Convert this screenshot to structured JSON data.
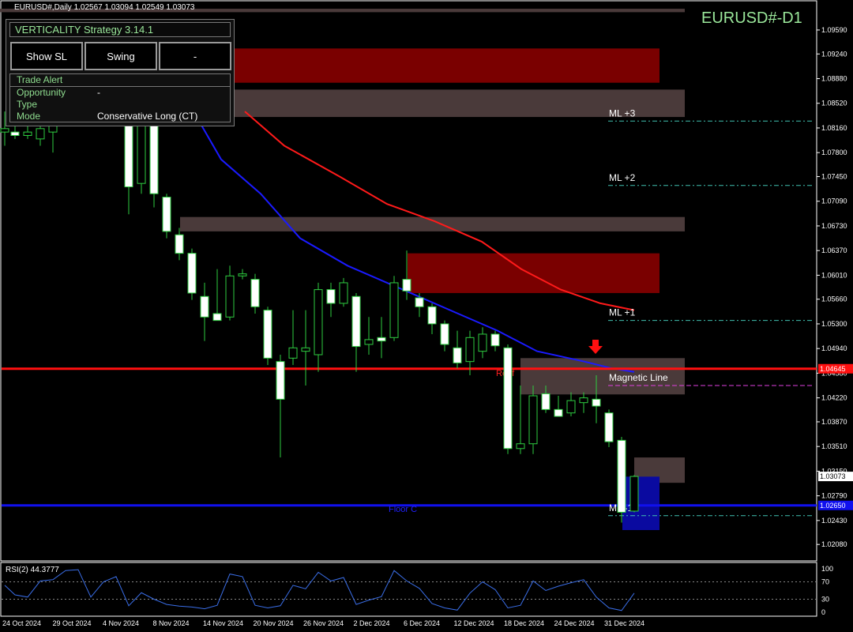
{
  "header": {
    "symbol_info": "EURUSD#,Daily  1.02567 1.03094 1.02549 1.03073",
    "title": "EURUSD#-D1"
  },
  "panel": {
    "title": "VERTICALITY Strategy 3.14.1",
    "buttons": [
      "Show SL",
      "Swing",
      "-"
    ],
    "rows": [
      {
        "key": "Trade Alert",
        "value": ""
      },
      {
        "key": "Opportunity",
        "value": "-"
      },
      {
        "key": "Type",
        "value": ""
      },
      {
        "key": "Mode",
        "value": "Conservative Long  (CT)"
      }
    ]
  },
  "chart_data": {
    "type": "candlestick",
    "y_range": [
      1.0184,
      1.0997
    ],
    "price_ticks": [
      "1.09590",
      "1.09240",
      "1.08880",
      "1.08520",
      "1.08160",
      "1.07800",
      "1.07450",
      "1.07090",
      "1.06730",
      "1.06370",
      "1.06010",
      "1.05660",
      "1.05300",
      "1.04940",
      "1.04580",
      "1.04220",
      "1.03870",
      "1.03510",
      "1.03150",
      "1.02790",
      "1.02430",
      "1.02080"
    ],
    "x_labels": [
      "24 Oct 2024",
      "29 Oct 2024",
      "4 Nov 2024",
      "8 Nov 2024",
      "14 Nov 2024",
      "20 Nov 2024",
      "26 Nov 2024",
      "2 Dec 2024",
      "6 Dec 2024",
      "12 Dec 2024",
      "18 Dec 2024",
      "24 Dec 2024",
      "31 Dec 2024"
    ],
    "current_price": "1.03073",
    "roof": {
      "value": 1.04645,
      "label": "1.04645",
      "text": "Roof"
    },
    "floor": {
      "value": 1.0265,
      "label": "1.02650",
      "text": "Floor C"
    },
    "levels": [
      {
        "name": "ML +3",
        "value": 1.0826
      },
      {
        "name": "ML +2",
        "value": 1.0732
      },
      {
        "name": "ML +1",
        "value": 1.0535
      },
      {
        "name": "Magnetic Line",
        "value": 1.044
      },
      {
        "name": "ML -1",
        "value": 1.025
      }
    ],
    "candles": [
      {
        "x": 6,
        "o": 1.081,
        "h": 1.084,
        "l": 1.079,
        "c": 1.0815
      },
      {
        "x": 19,
        "o": 1.081,
        "h": 1.083,
        "l": 1.08,
        "c": 1.0805
      },
      {
        "x": 35,
        "o": 1.0805,
        "h": 1.0825,
        "l": 1.08,
        "c": 1.081
      },
      {
        "x": 51,
        "o": 1.08,
        "h": 1.0825,
        "l": 1.079,
        "c": 1.0815
      },
      {
        "x": 67,
        "o": 1.081,
        "h": 1.083,
        "l": 1.078,
        "c": 1.082
      },
      {
        "x": 163,
        "o": 1.0838,
        "h": 1.085,
        "l": 1.069,
        "c": 1.073
      },
      {
        "x": 179,
        "o": 1.0735,
        "h": 1.086,
        "l": 1.072,
        "c": 1.084
      },
      {
        "x": 195,
        "o": 1.084,
        "h": 1.085,
        "l": 1.07,
        "c": 1.072
      },
      {
        "x": 211,
        "o": 1.0715,
        "h": 1.072,
        "l": 1.0655,
        "c": 1.0665
      },
      {
        "x": 227,
        "o": 1.066,
        "h": 1.067,
        "l": 1.0623,
        "c": 1.0633
      },
      {
        "x": 243,
        "o": 1.0633,
        "h": 1.064,
        "l": 1.0565,
        "c": 1.0575
      },
      {
        "x": 259,
        "o": 1.057,
        "h": 1.059,
        "l": 1.0505,
        "c": 1.054
      },
      {
        "x": 275,
        "o": 1.0545,
        "h": 1.061,
        "l": 1.054,
        "c": 1.0535
      },
      {
        "x": 291,
        "o": 1.054,
        "h": 1.0615,
        "l": 1.0535,
        "c": 1.06
      },
      {
        "x": 307,
        "o": 1.06,
        "h": 1.061,
        "l": 1.0595,
        "c": 1.0603
      },
      {
        "x": 323,
        "o": 1.0595,
        "h": 1.0603,
        "l": 1.0545,
        "c": 1.0555
      },
      {
        "x": 339,
        "o": 1.055,
        "h": 1.0555,
        "l": 1.047,
        "c": 1.048
      },
      {
        "x": 355,
        "o": 1.0475,
        "h": 1.0485,
        "l": 1.0335,
        "c": 1.042
      },
      {
        "x": 371,
        "o": 1.048,
        "h": 1.055,
        "l": 1.047,
        "c": 1.0495
      },
      {
        "x": 387,
        "o": 1.049,
        "h": 1.055,
        "l": 1.044,
        "c": 1.0495
      },
      {
        "x": 403,
        "o": 1.0485,
        "h": 1.059,
        "l": 1.046,
        "c": 1.058
      },
      {
        "x": 419,
        "o": 1.058,
        "h": 1.059,
        "l": 1.054,
        "c": 1.056
      },
      {
        "x": 435,
        "o": 1.056,
        "h": 1.0597,
        "l": 1.0555,
        "c": 1.059
      },
      {
        "x": 451,
        "o": 1.057,
        "h": 1.0575,
        "l": 1.046,
        "c": 1.0497
      },
      {
        "x": 467,
        "o": 1.05,
        "h": 1.054,
        "l": 1.0485,
        "c": 1.0507
      },
      {
        "x": 483,
        "o": 1.051,
        "h": 1.054,
        "l": 1.048,
        "c": 1.0505
      },
      {
        "x": 499,
        "o": 1.051,
        "h": 1.06,
        "l": 1.0505,
        "c": 1.059
      },
      {
        "x": 515,
        "o": 1.0595,
        "h": 1.0637,
        "l": 1.0565,
        "c": 1.0578
      },
      {
        "x": 531,
        "o": 1.0568,
        "h": 1.0575,
        "l": 1.054,
        "c": 1.0555
      },
      {
        "x": 547,
        "o": 1.0555,
        "h": 1.056,
        "l": 1.0515,
        "c": 1.053
      },
      {
        "x": 563,
        "o": 1.053,
        "h": 1.0535,
        "l": 1.049,
        "c": 1.05
      },
      {
        "x": 579,
        "o": 1.0495,
        "h": 1.052,
        "l": 1.0465,
        "c": 1.0473
      },
      {
        "x": 595,
        "o": 1.0475,
        "h": 1.052,
        "l": 1.0455,
        "c": 1.051
      },
      {
        "x": 611,
        "o": 1.049,
        "h": 1.0525,
        "l": 1.048,
        "c": 1.0515
      },
      {
        "x": 627,
        "o": 1.0515,
        "h": 1.052,
        "l": 1.049,
        "c": 1.0498
      },
      {
        "x": 643,
        "o": 1.0495,
        "h": 1.05,
        "l": 1.034,
        "c": 1.0348
      },
      {
        "x": 659,
        "o": 1.0348,
        "h": 1.044,
        "l": 1.034,
        "c": 1.0355
      },
      {
        "x": 675,
        "o": 1.0355,
        "h": 1.044,
        "l": 1.034,
        "c": 1.0425
      },
      {
        "x": 691,
        "o": 1.0428,
        "h": 1.044,
        "l": 1.04,
        "c": 1.0405
      },
      {
        "x": 707,
        "o": 1.0405,
        "h": 1.0425,
        "l": 1.0395,
        "c": 1.0395
      },
      {
        "x": 723,
        "o": 1.04,
        "h": 1.043,
        "l": 1.0395,
        "c": 1.0418
      },
      {
        "x": 739,
        "o": 1.0415,
        "h": 1.043,
        "l": 1.04,
        "c": 1.0422
      },
      {
        "x": 755,
        "o": 1.042,
        "h": 1.0455,
        "l": 1.0385,
        "c": 1.041
      },
      {
        "x": 771,
        "o": 1.04,
        "h": 1.0405,
        "l": 1.035,
        "c": 1.0358
      },
      {
        "x": 787,
        "o": 1.036,
        "h": 1.0365,
        "l": 1.024,
        "c": 1.0255
      },
      {
        "x": 803,
        "o": 1.02567,
        "h": 1.03094,
        "l": 1.02549,
        "c": 1.03073
      }
    ],
    "ma_red": [
      [
        310,
        1.084
      ],
      [
        360,
        1.079
      ],
      [
        430,
        1.0745
      ],
      [
        490,
        1.0705
      ],
      [
        550,
        1.068
      ],
      [
        610,
        1.065
      ],
      [
        660,
        1.061
      ],
      [
        710,
        1.058
      ],
      [
        760,
        1.056
      ],
      [
        803,
        1.055
      ]
    ],
    "ma_blue": [
      [
        240,
        1.085
      ],
      [
        280,
        1.077
      ],
      [
        330,
        1.072
      ],
      [
        380,
        1.0655
      ],
      [
        440,
        1.0615
      ],
      [
        510,
        1.058
      ],
      [
        580,
        1.0545
      ],
      [
        630,
        1.052
      ],
      [
        680,
        1.049
      ],
      [
        740,
        1.0475
      ],
      [
        775,
        1.0465
      ],
      [
        803,
        1.046
      ]
    ],
    "zones": [
      {
        "x1": 292,
        "x2": 835,
        "top": 1.0932,
        "bot": 1.0882,
        "color": "#7a0000"
      },
      {
        "x1": 292,
        "x2": 867,
        "top": 1.0872,
        "bot": 1.0832,
        "color": "#4a3a3a"
      },
      {
        "x1": 0,
        "x2": 867,
        "top": 1.099,
        "bot": 1.0985,
        "color": "#4a3a3a"
      },
      {
        "x1": 228,
        "x2": 867,
        "top": 1.0686,
        "bot": 1.0665,
        "color": "#4a3a3a"
      },
      {
        "x1": 516,
        "x2": 835,
        "top": 1.0633,
        "bot": 1.0575,
        "color": "#7a0000"
      },
      {
        "x1": 659,
        "x2": 867,
        "top": 1.048,
        "bot": 1.0427,
        "color": "#4a3a3a"
      },
      {
        "x1": 803,
        "x2": 867,
        "top": 1.0335,
        "bot": 1.0298,
        "color": "#4a3a3a"
      },
      {
        "x1": 788,
        "x2": 835,
        "top": 1.0307,
        "bot": 1.0229,
        "color": "#0a0aa0"
      }
    ],
    "rsi": {
      "label": "RSI(2) 44.3777",
      "ticks": [
        "100",
        "70",
        "30",
        "0"
      ],
      "values": [
        [
          6,
          62
        ],
        [
          19,
          40
        ],
        [
          35,
          35
        ],
        [
          51,
          72
        ],
        [
          67,
          75
        ],
        [
          83,
          96
        ],
        [
          99,
          98
        ],
        [
          115,
          35
        ],
        [
          131,
          70
        ],
        [
          147,
          82
        ],
        [
          163,
          15
        ],
        [
          179,
          45
        ],
        [
          195,
          30
        ],
        [
          211,
          18
        ],
        [
          227,
          14
        ],
        [
          243,
          12
        ],
        [
          259,
          8
        ],
        [
          275,
          16
        ],
        [
          291,
          88
        ],
        [
          307,
          82
        ],
        [
          323,
          16
        ],
        [
          339,
          10
        ],
        [
          355,
          15
        ],
        [
          371,
          62
        ],
        [
          387,
          54
        ],
        [
          403,
          92
        ],
        [
          419,
          72
        ],
        [
          435,
          80
        ],
        [
          451,
          18
        ],
        [
          467,
          28
        ],
        [
          483,
          36
        ],
        [
          499,
          96
        ],
        [
          515,
          72
        ],
        [
          531,
          55
        ],
        [
          547,
          20
        ],
        [
          563,
          10
        ],
        [
          579,
          5
        ],
        [
          595,
          44
        ],
        [
          611,
          70
        ],
        [
          627,
          52
        ],
        [
          643,
          10
        ],
        [
          659,
          16
        ],
        [
          675,
          72
        ],
        [
          691,
          50
        ],
        [
          707,
          60
        ],
        [
          723,
          68
        ],
        [
          739,
          75
        ],
        [
          755,
          35
        ],
        [
          771,
          10
        ],
        [
          787,
          4
        ],
        [
          803,
          44
        ]
      ]
    }
  }
}
